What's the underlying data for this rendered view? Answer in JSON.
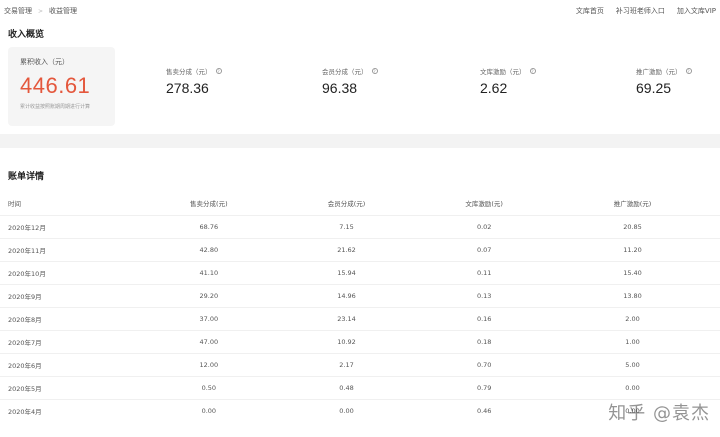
{
  "breadcrumb": [
    "交易管理",
    "收益管理"
  ],
  "top_links": [
    "文库首页",
    "补习班老师入口",
    "加入文库VIP"
  ],
  "overview": {
    "title": "收入概览",
    "total": {
      "label": "累积收入（元）",
      "value": "446.61",
      "note": "累计收益按照账期周期进行计算"
    },
    "stats": [
      {
        "label": "售卖分成（元）",
        "value": "278.36"
      },
      {
        "label": "会员分成（元）",
        "value": "96.38"
      },
      {
        "label": "文库激励（元）",
        "value": "2.62"
      },
      {
        "label": "推广激励（元）",
        "value": "69.25"
      }
    ]
  },
  "details": {
    "title": "账单详情",
    "columns": [
      "时间",
      "售卖分成(元)",
      "会员分成(元)",
      "文库激励(元)",
      "推广激励(元)"
    ],
    "rows": [
      [
        "2020年12月",
        "68.76",
        "7.15",
        "0.02",
        "20.85"
      ],
      [
        "2020年11月",
        "42.80",
        "21.62",
        "0.07",
        "11.20"
      ],
      [
        "2020年10月",
        "41.10",
        "15.94",
        "0.11",
        "15.40"
      ],
      [
        "2020年9月",
        "29.20",
        "14.96",
        "0.13",
        "13.80"
      ],
      [
        "2020年8月",
        "37.00",
        "23.14",
        "0.16",
        "2.00"
      ],
      [
        "2020年7月",
        "47.00",
        "10.92",
        "0.18",
        "1.00"
      ],
      [
        "2020年6月",
        "12.00",
        "2.17",
        "0.70",
        "5.00"
      ],
      [
        "2020年5月",
        "0.50",
        "0.48",
        "0.79",
        "0.00"
      ],
      [
        "2020年4月",
        "0.00",
        "0.00",
        "0.46",
        "0.00"
      ]
    ]
  },
  "watermark": "知乎 @袁杰"
}
